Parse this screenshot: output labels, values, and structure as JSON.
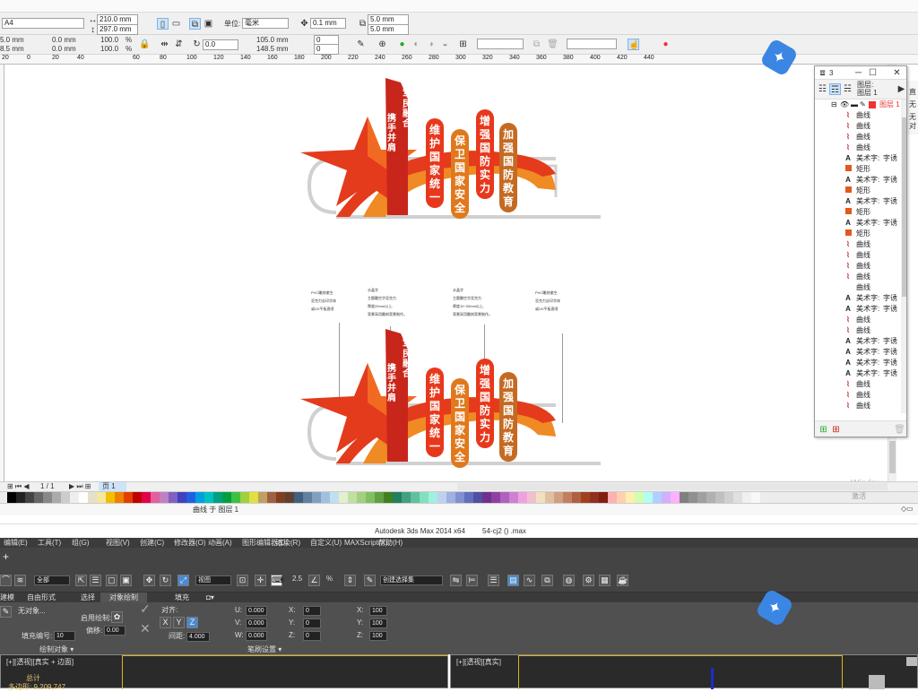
{
  "property_bar": {
    "page_size": "A4",
    "width": "210.0 mm",
    "height": "297.0 mm",
    "units_label": "单位:",
    "units_value": "毫米",
    "nudge": "0.1 mm",
    "dup_x": "5.0 mm",
    "dup_y": "5.0 mm"
  },
  "toolbar2": {
    "left_x": "5.0 mm",
    "left_y": "8.5 mm",
    "pos_x": "0.0 mm",
    "pos_y": "0.0 mm",
    "scale_x": "100.0",
    "scale_y": "100.0",
    "pct": "%",
    "rotate": "0.0",
    "ox": "105.0 mm",
    "oy": "148.5 mm",
    "ang1": "0",
    "ang2": "0"
  },
  "ruler": {
    "ticks": [
      "60",
      "80",
      "100",
      "120",
      "140",
      "160",
      "180",
      "200",
      "220",
      "240",
      "260",
      "280",
      "300",
      "320",
      "340",
      "360",
      "380",
      "400",
      "420",
      "440"
    ],
    "ticks_left": [
      "20",
      "0",
      "20",
      "40"
    ]
  },
  "artwork": {
    "flag_text": "军民融合",
    "flag_text2": "携手并肩",
    "pills": [
      {
        "text": "维护国家统一",
        "color": "#e8381c"
      },
      {
        "text": "保卫国家安全",
        "color": "#e0781d"
      },
      {
        "text": "增强国防实力",
        "color": "#e8381c"
      },
      {
        "text": "加强国防教育",
        "color": "#c46a22"
      }
    ],
    "notes": [
      [
        "PVC雕刻镂空,",
        "亚克力丝印字体",
        "或UV平板直喷"
      ],
      [
        "水晶字",
        "主题雕空字亚克力",
        "厚度20mm以上,",
        "背景采用雕刻背景制作。"
      ],
      [
        "水晶字",
        "主题雕空字亚克力",
        "厚度10~20mm以上,",
        "背景采用雕刻背景制作。"
      ],
      [
        "PVC雕刻镂空,",
        "亚克力丝印字体",
        "或UV平板直喷"
      ]
    ]
  },
  "layers_panel": {
    "icon": "3",
    "header1": "图层:",
    "header2": "图层 1",
    "layer_name": "图层 1",
    "items": [
      {
        "glyph": "curve",
        "name": "曲线",
        "extra": ""
      },
      {
        "glyph": "curve",
        "name": "曲线",
        "extra": ""
      },
      {
        "glyph": "curve",
        "name": "曲线",
        "extra": ""
      },
      {
        "glyph": "curve",
        "name": "曲线",
        "extra": ""
      },
      {
        "glyph": "A",
        "name": "美术字:",
        "extra": "字诱"
      },
      {
        "glyph": "rect",
        "name": "矩形",
        "extra": ""
      },
      {
        "glyph": "A",
        "name": "美术字:",
        "extra": "字诱"
      },
      {
        "glyph": "rect",
        "name": "矩形",
        "extra": ""
      },
      {
        "glyph": "A",
        "name": "美术字:",
        "extra": "字诱"
      },
      {
        "glyph": "rect",
        "name": "矩形",
        "extra": ""
      },
      {
        "glyph": "A",
        "name": "美术字:",
        "extra": "字诱"
      },
      {
        "glyph": "rect",
        "name": "矩形",
        "extra": ""
      },
      {
        "glyph": "curve",
        "name": "曲线",
        "extra": ""
      },
      {
        "glyph": "curve",
        "name": "曲线",
        "extra": ""
      },
      {
        "glyph": "curve",
        "name": "曲线",
        "extra": ""
      },
      {
        "glyph": "curve",
        "name": "曲线",
        "extra": ""
      },
      {
        "glyph": "blank",
        "name": "曲线",
        "extra": ""
      },
      {
        "glyph": "A",
        "name": "美术字:",
        "extra": "字诱"
      },
      {
        "glyph": "A",
        "name": "美术字:",
        "extra": "字诱"
      },
      {
        "glyph": "curve",
        "name": "曲线",
        "extra": ""
      },
      {
        "glyph": "curve",
        "name": "曲线",
        "extra": ""
      },
      {
        "glyph": "A",
        "name": "美术字:",
        "extra": "字诱"
      },
      {
        "glyph": "A",
        "name": "美术字:",
        "extra": "字诱"
      },
      {
        "glyph": "A",
        "name": "美术字:",
        "extra": "字诱"
      },
      {
        "glyph": "A",
        "name": "美术字:",
        "extra": "字诱"
      },
      {
        "glyph": "curve",
        "name": "曲线",
        "extra": ""
      },
      {
        "glyph": "curve",
        "name": "曲线",
        "extra": ""
      },
      {
        "glyph": "curve",
        "name": "曲线",
        "extra": ""
      }
    ]
  },
  "right_edge": {
    "t1": "直",
    "t2": "无",
    "t3": "无",
    "t4": "对"
  },
  "page_nav": {
    "page": "1 / 1",
    "tab": "页 1"
  },
  "statusbar": {
    "text": "曲线 于 图层 1"
  },
  "watermark": {
    "windows": "Window",
    "activate": "激活"
  },
  "max_title": {
    "app": "Autodesk 3ds Max  2014 x64",
    "file": "54-cj2 () .max"
  },
  "max_menu": [
    "编辑(E)",
    "工具(T)",
    "组(G)",
    "视图(V)",
    "创建(C)",
    "修改器(O)",
    "动画(A)",
    "图形编辑器(D)",
    "渲染(R)",
    "自定义(U)",
    "MAXScript(X)",
    "帮助(H)"
  ],
  "max_toolbar": {
    "filter": "全部",
    "view": "视图",
    "selset": "创建选择集",
    "snap": "2.5",
    "pct": "%"
  },
  "max_ribbon_tabs": [
    "建模",
    "自由形式",
    "选择",
    "对象绘制",
    "填充"
  ],
  "max_panel": {
    "no_object": "无对象...",
    "fill_num_label": "填充编号:",
    "fill_num": "10",
    "enable_paint": "启用绘制:",
    "offset_label": "偏移:",
    "offset": "0.00",
    "align_label": "对齐:",
    "spacing_label": "间距:",
    "spacing": "4.000",
    "u": "0.000",
    "v": "0.000",
    "w": "0.000",
    "deg_x": "0",
    "deg_y": "0",
    "deg_z": "0",
    "sx": "100",
    "sy": "100",
    "sz": "100",
    "section1": "绘制对象 ▾",
    "section2": "笔刷设置 ▾"
  },
  "viewports": {
    "left_label": "[+][透视][真实 + 边面]",
    "left_stat1": "总计",
    "left_stat2": "多边形: 9,209,747",
    "right_label": "[+][透视][真实]"
  }
}
